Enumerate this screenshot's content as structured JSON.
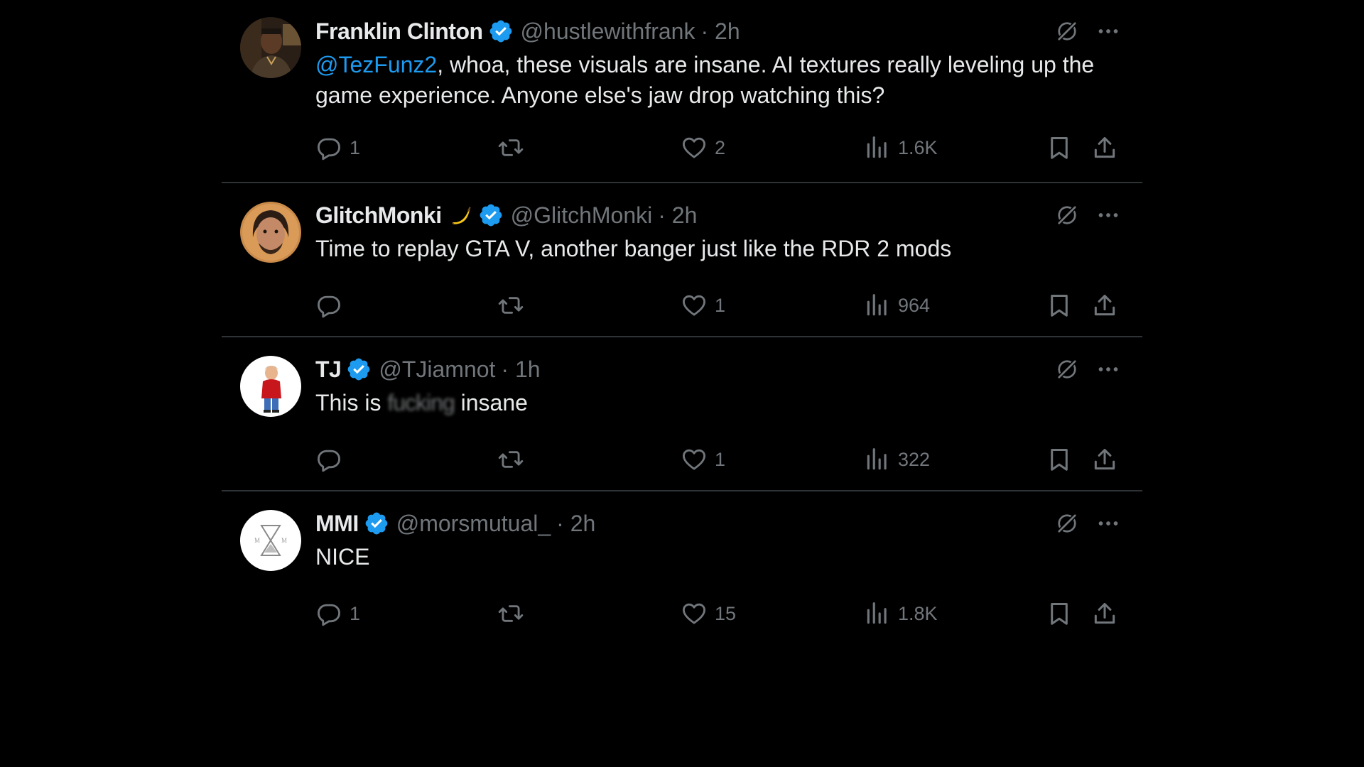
{
  "colors": {
    "background": "#000000",
    "text": "#e7e9ea",
    "muted": "#71767b",
    "accent": "#1d9bf0",
    "divider": "#2f3336"
  },
  "tweets": [
    {
      "name": "Franklin Clinton",
      "verified": true,
      "emoji": "",
      "handle": "@hustlewithfrank",
      "time": "· 2h",
      "mention": "@TezFunz2",
      "text": ", whoa, these visuals are insane. AI textures really leveling up the game experience. Anyone else's jaw drop watching this?",
      "replies": "1",
      "reposts": "",
      "likes": "2",
      "views": "1.6K",
      "avatar_icon": "franklin-avatar"
    },
    {
      "name": "GlitchMonki",
      "verified": true,
      "emoji": "banana-emoji",
      "handle": "@GlitchMonki",
      "time": "· 2h",
      "text": "Time to replay GTA V, another banger just like the RDR 2 mods",
      "replies": "",
      "reposts": "",
      "likes": "1",
      "views": "964",
      "avatar_icon": "glitchmonki-avatar"
    },
    {
      "name": "TJ",
      "verified": true,
      "emoji": "",
      "handle": "@TJiamnot",
      "time": "· 1h",
      "text_before": "This is ",
      "text_censored": "fucking",
      "text_after": " insane",
      "replies": "",
      "reposts": "",
      "likes": "1",
      "views": "322",
      "avatar_icon": "tj-avatar"
    },
    {
      "name": "MMI",
      "verified": true,
      "emoji": "",
      "handle": "@morsmutual_",
      "time": "· 2h",
      "text": "NICE",
      "replies": "1",
      "reposts": "",
      "likes": "15",
      "views": "1.8K",
      "avatar_icon": "mmi-logo-avatar"
    }
  ]
}
